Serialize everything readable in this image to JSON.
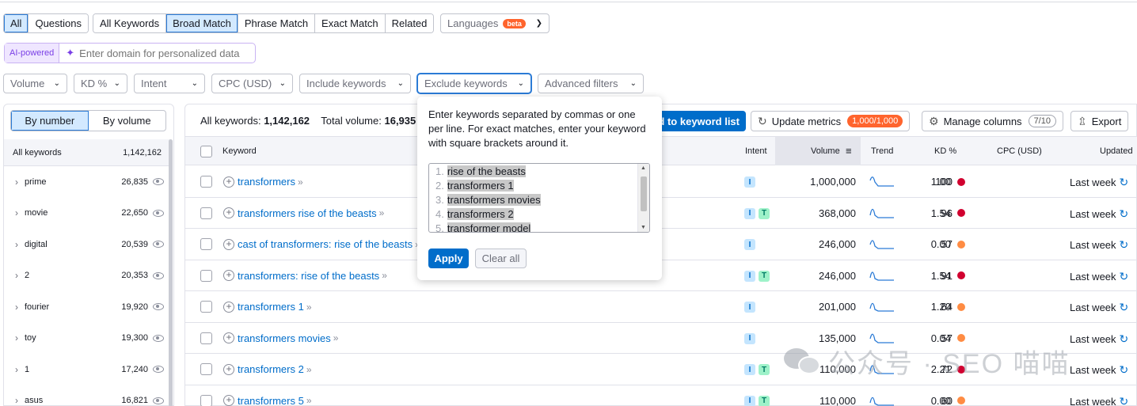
{
  "tabs_left": [
    "All",
    "Questions"
  ],
  "tabs_match": [
    "All Keywords",
    "Broad Match",
    "Phrase Match",
    "Exact Match",
    "Related"
  ],
  "languages": {
    "label": "Languages",
    "badge": "beta"
  },
  "ai": {
    "label": "AI-powered",
    "placeholder": "Enter domain for personalized data"
  },
  "filters": [
    "Volume",
    "KD %",
    "Intent",
    "CPC (USD)",
    "Include keywords",
    "Exclude keywords",
    "Advanced filters"
  ],
  "left_panel": {
    "toggle": [
      "By number",
      "By volume"
    ],
    "header": {
      "label": "All keywords",
      "count": "1,142,162"
    },
    "groups": [
      {
        "name": "prime",
        "count": "26,835"
      },
      {
        "name": "movie",
        "count": "22,650"
      },
      {
        "name": "digital",
        "count": "20,539"
      },
      {
        "name": "2",
        "count": "20,353"
      },
      {
        "name": "fourier",
        "count": "19,920"
      },
      {
        "name": "toy",
        "count": "19,300"
      },
      {
        "name": "1",
        "count": "17,240"
      },
      {
        "name": "asus",
        "count": "16,821"
      }
    ]
  },
  "summary": {
    "all_label": "All keywords:",
    "all_value": "1,142,162",
    "vol_label": "Total volume:",
    "vol_value": "16,935"
  },
  "actions": {
    "add_label": "d to keyword list",
    "update_label": "Update metrics",
    "update_count": "1,000/1,000",
    "manage_label": "Manage columns",
    "manage_count": "7/10",
    "export_label": "Export"
  },
  "columns": {
    "keyword": "Keyword",
    "intent": "Intent",
    "volume": "Volume",
    "trend": "Trend",
    "kd": "KD %",
    "cpc": "CPC (USD)",
    "updated": "Updated"
  },
  "rows": [
    {
      "keyword": "transformers",
      "intent": [
        "I"
      ],
      "volume": "1,000,000",
      "kd": "100",
      "kd_color": "#d1002f",
      "cpc": "1.00",
      "updated": "Last week"
    },
    {
      "keyword": "transformers rise of the beasts",
      "intent": [
        "I",
        "T"
      ],
      "volume": "368,000",
      "kd": "96",
      "kd_color": "#d1002f",
      "cpc": "1.54",
      "updated": "Last week"
    },
    {
      "keyword": "cast of transformers: rise of the beasts",
      "intent": [
        "I"
      ],
      "volume": "246,000",
      "kd": "57",
      "kd_color": "#ff8c43",
      "cpc": "0.00",
      "updated": "Last week"
    },
    {
      "keyword": "transformers: rise of the beasts",
      "intent": [
        "I",
        "T"
      ],
      "volume": "246,000",
      "kd": "91",
      "kd_color": "#d1002f",
      "cpc": "1.54",
      "updated": "Last week"
    },
    {
      "keyword": "transformers 1",
      "intent": [
        "I"
      ],
      "volume": "201,000",
      "kd": "64",
      "kd_color": "#ff8c43",
      "cpc": "1.20",
      "updated": "Last week"
    },
    {
      "keyword": "transformers movies",
      "intent": [
        "I"
      ],
      "volume": "135,000",
      "kd": "57",
      "kd_color": "#ff8c43",
      "cpc": "0.04",
      "updated": "Last week"
    },
    {
      "keyword": "transformers 2",
      "intent": [
        "I",
        "T"
      ],
      "volume": "110,000",
      "kd": "72",
      "kd_color": "#d1002f",
      "cpc": "2.21",
      "updated": "Last week"
    },
    {
      "keyword": "transformers 5",
      "intent": [
        "I",
        "T"
      ],
      "volume": "110,000",
      "kd": "60",
      "kd_color": "#ff8c43",
      "cpc": "0.00",
      "updated": "Last week"
    }
  ],
  "popover": {
    "instructions": "Enter keywords separated by commas or one per line. For exact matches, enter your keyword with square brackets around it.",
    "lines": [
      "rise of the beasts",
      "transformers 1",
      "transformers movies",
      "transformers 2",
      "transformer model"
    ],
    "apply": "Apply",
    "clear": "Clear all"
  },
  "watermark": "公众号 · SEO 喵喵"
}
